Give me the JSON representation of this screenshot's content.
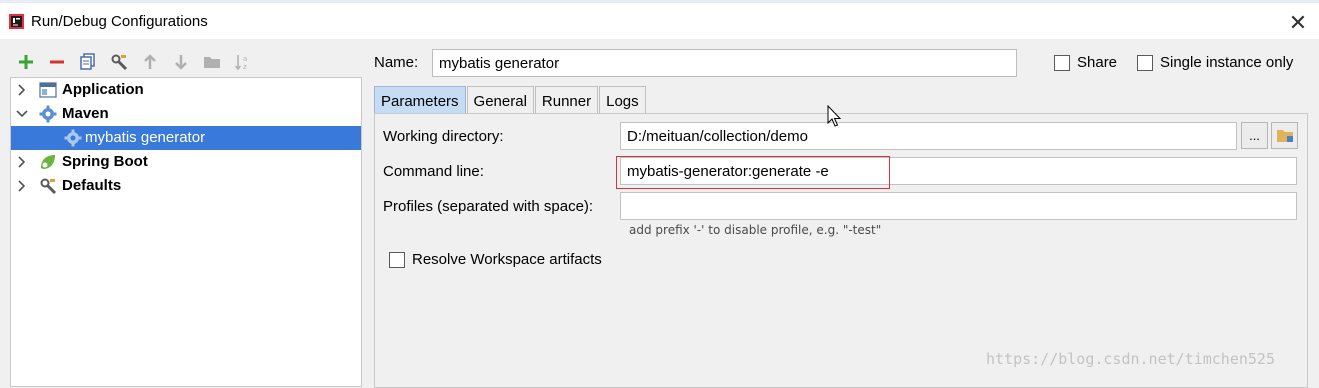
{
  "window": {
    "title": "Run/Debug Configurations",
    "app_icon": "intellij-idea-icon",
    "close_icon": "close-icon",
    "close_glyph": "✕"
  },
  "toolbar": {
    "buttons": [
      {
        "name": "add-icon",
        "color": "#3aa33a"
      },
      {
        "name": "remove-icon",
        "color": "#d9342b"
      },
      {
        "name": "copy-icon",
        "color": "#4a6fa5"
      },
      {
        "name": "edit-defaults-icon",
        "color": "#5a5a5a"
      },
      {
        "name": "move-up-icon",
        "color": "#b0b0b0"
      },
      {
        "name": "move-down-icon",
        "color": "#b0b0b0"
      },
      {
        "name": "folder-icon",
        "color": "#b0b0b0"
      },
      {
        "name": "sort-icon",
        "color": "#b0b0b0"
      }
    ]
  },
  "tree": {
    "items": [
      {
        "label": "Application",
        "expanded": false,
        "icon": "application-icon"
      },
      {
        "label": "Maven",
        "expanded": true,
        "icon": "maven-gear-icon"
      },
      {
        "label": "mybatis generator",
        "selected": true,
        "icon": "maven-gear-icon"
      },
      {
        "label": "Spring Boot",
        "expanded": false,
        "icon": "spring-boot-icon"
      },
      {
        "label": "Defaults",
        "expanded": false,
        "icon": "defaults-wrench-icon"
      }
    ]
  },
  "config": {
    "name_label": "Name:",
    "name_value": "mybatis generator",
    "share_label": "Share",
    "share_checked": false,
    "single_instance_label": "Single instance only",
    "single_instance_checked": false
  },
  "tabs": [
    {
      "label": "Parameters",
      "active": true
    },
    {
      "label": "General",
      "active": false
    },
    {
      "label": "Runner",
      "active": false
    },
    {
      "label": "Logs",
      "active": false
    }
  ],
  "parameters": {
    "working_dir_label": "Working directory:",
    "working_dir_value": "D:/meituan/collection/demo",
    "browse_label": "...",
    "command_line_label": "Command line:",
    "command_line_value": "mybatis-generator:generate -e",
    "profiles_label": "Profiles (separated with space):",
    "profiles_value": "",
    "profiles_hint": "add prefix '-' to disable profile, e.g. \"-test\"",
    "resolve_workspace_label": "Resolve Workspace artifacts",
    "resolve_workspace_checked": false
  },
  "highlight_color": "#d6343b",
  "accent_color": "#3879d9",
  "watermark": "https://blog.csdn.net/timchen525"
}
